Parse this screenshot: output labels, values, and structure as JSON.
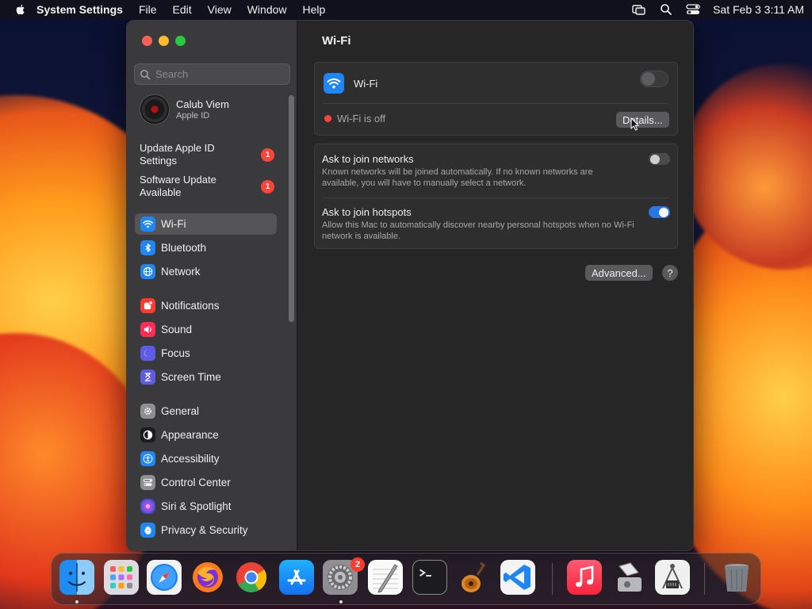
{
  "menubar": {
    "app_name": "System Settings",
    "menus": [
      "File",
      "Edit",
      "View",
      "Window",
      "Help"
    ],
    "clock": "Sat Feb 3  3:11 AM"
  },
  "sidebar": {
    "search_placeholder": "Search",
    "profile": {
      "name": "Calub Viem",
      "subtitle": "Apple ID"
    },
    "notices": [
      {
        "label": "Update Apple ID Settings",
        "badge": "1"
      },
      {
        "label": "Software Update Available",
        "badge": "1"
      }
    ],
    "items": [
      {
        "label": "Wi-Fi",
        "icon": "wifi-icon",
        "color": "#1f86f6",
        "selected": true
      },
      {
        "label": "Bluetooth",
        "icon": "bluetooth-icon",
        "color": "#1f86f6"
      },
      {
        "label": "Network",
        "icon": "globe-icon",
        "color": "#1f86f6"
      },
      {
        "label": "Notifications",
        "icon": "bell-icon",
        "color": "#ff3b30"
      },
      {
        "label": "Sound",
        "icon": "speaker-icon",
        "color": "#ff2d55"
      },
      {
        "label": "Focus",
        "icon": "moon-icon",
        "color": "#5e5ce6"
      },
      {
        "label": "Screen Time",
        "icon": "hourglass-icon",
        "color": "#5e5ce6"
      },
      {
        "label": "General",
        "icon": "gear-icon",
        "color": "#8e8e93"
      },
      {
        "label": "Appearance",
        "icon": "appearance-icon",
        "color": "#1c1c1e"
      },
      {
        "label": "Accessibility",
        "icon": "accessibility-icon",
        "color": "#1f86f6"
      },
      {
        "label": "Control Center",
        "icon": "control-center-icon",
        "color": "#8e8e93"
      },
      {
        "label": "Siri & Spotlight",
        "icon": "siri-icon",
        "color": "#2b2b6e"
      },
      {
        "label": "Privacy & Security",
        "icon": "hand-icon",
        "color": "#1f86f6"
      }
    ]
  },
  "main": {
    "title": "Wi-Fi",
    "wifi": {
      "label": "Wi-Fi",
      "enabled": false,
      "status": "Wi-Fi is off",
      "status_color": "#ff453a",
      "details_button": "Details..."
    },
    "options": [
      {
        "label": "Ask to join networks",
        "description": "Known networks will be joined automatically. If no known networks are available, you will have to manually select a network.",
        "enabled": false
      },
      {
        "label": "Ask to join hotspots",
        "description": "Allow this Mac to automatically discover nearby personal hotspots when no Wi-Fi network is available.",
        "enabled": true
      }
    ],
    "advanced_button": "Advanced...",
    "help_button": "?"
  },
  "dock": {
    "apps": [
      {
        "name": "finder-app-icon",
        "running": true
      },
      {
        "name": "launchpad-app-icon"
      },
      {
        "name": "safari-app-icon"
      },
      {
        "name": "firefox-app-icon"
      },
      {
        "name": "chrome-app-icon"
      },
      {
        "name": "app-store-app-icon"
      },
      {
        "name": "system-settings-app-icon",
        "running": true,
        "badge": "2"
      },
      {
        "name": "textedit-app-icon"
      },
      {
        "name": "terminal-app-icon"
      },
      {
        "name": "garageband-app-icon"
      },
      {
        "name": "vscode-app-icon"
      },
      {
        "name": "music-app-icon"
      },
      {
        "name": "disk-utility-app-icon"
      },
      {
        "name": "system-information-app-icon"
      },
      {
        "name": "trash-icon"
      }
    ]
  }
}
